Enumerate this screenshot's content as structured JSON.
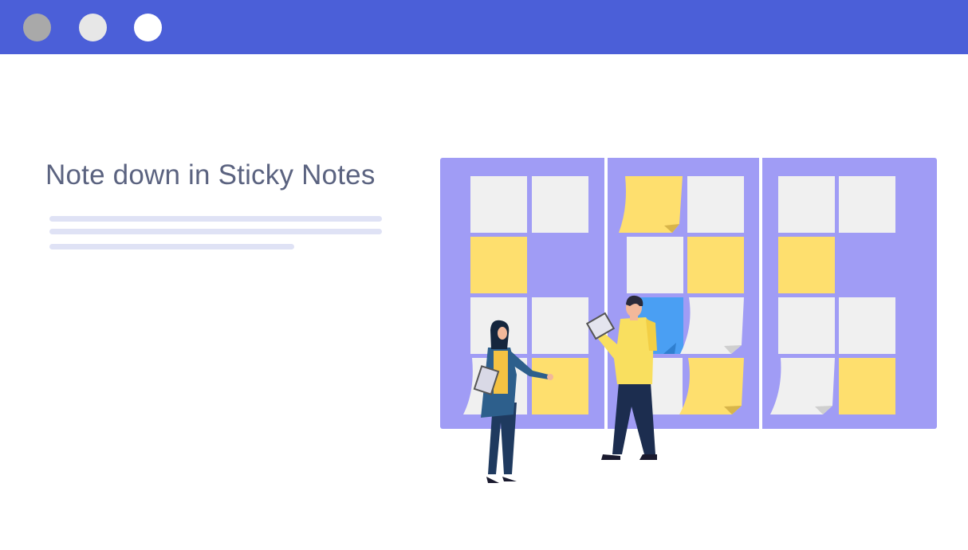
{
  "window": {
    "controls": [
      "window-dot-1",
      "window-dot-2",
      "window-dot-3"
    ]
  },
  "hero": {
    "title": "Note down in Sticky Notes"
  },
  "illustration": {
    "name": "kanban-board-illustration",
    "colors": {
      "board": "#a09cf5",
      "note_gray": "#f0f0f0",
      "note_yellow": "#fedf6e",
      "note_blue": "#4a9ff3",
      "titlebar": "#4b5fd8"
    }
  }
}
